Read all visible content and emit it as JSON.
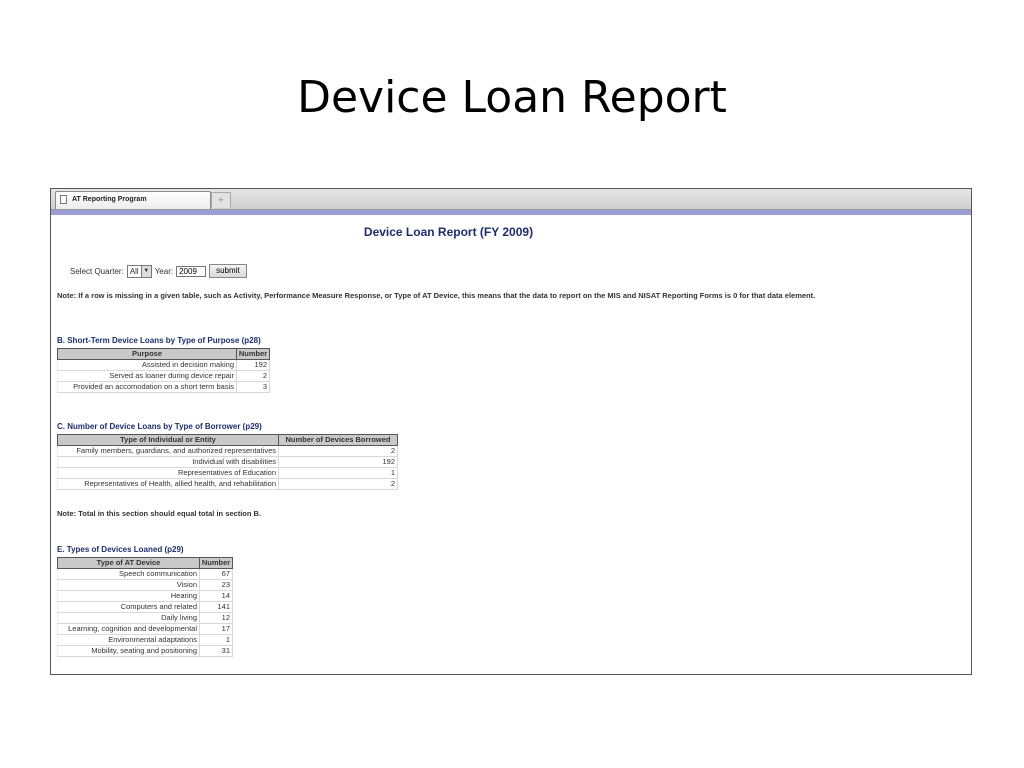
{
  "slide": {
    "title": "Device Loan Report"
  },
  "browser": {
    "tab_label": "AT Reporting Program",
    "new_tab_symbol": "+"
  },
  "report": {
    "title": "Device Loan Report (FY 2009)",
    "controls": {
      "quarter_label": "Select Quarter:",
      "quarter_value": "All",
      "year_label": "Year:",
      "year_value": "2009",
      "submit_label": "submit"
    },
    "note": "Note: If a row is missing in a given table, such as Activity, Performance Measure Response, or Type of AT Device, this means that the data to report on the MIS and NISAT Reporting Forms is 0 for that data element.",
    "section_b": {
      "title": "B. Short-Term Device Loans by Type of Purpose (p28)",
      "headers": [
        "Purpose",
        "Number"
      ],
      "rows": [
        [
          "Assisted in decision making",
          "192"
        ],
        [
          "Served as loaner during device repair",
          "2"
        ],
        [
          "Provided an accomodation on a short term basis",
          "3"
        ]
      ]
    },
    "section_c": {
      "title": "C. Number of Device Loans by Type of Borrower (p29)",
      "headers": [
        "Type of Individual or Entity",
        "Number of Devices Borrowed"
      ],
      "rows": [
        [
          "Family members, guardians, and authorized representatives",
          "2"
        ],
        [
          "Individual with disabilities",
          "192"
        ],
        [
          "Representatives of Education",
          "1"
        ],
        [
          "Representatives of Health, allied health, and rehabilitation",
          "2"
        ]
      ],
      "note": "Note: Total in this section should equal total in section B."
    },
    "section_e": {
      "title": "E. Types of Devices Loaned (p29)",
      "headers": [
        "Type of AT Device",
        "Number"
      ],
      "rows": [
        [
          "Speech communication",
          "67"
        ],
        [
          "Vision",
          "23"
        ],
        [
          "Hearing",
          "14"
        ],
        [
          "Computers and related",
          "141"
        ],
        [
          "Daily living",
          "12"
        ],
        [
          "Learning, cognition and developmental",
          "17"
        ],
        [
          "Environmental adaptations",
          "1"
        ],
        [
          "Mobility, seating and positioning",
          "31"
        ]
      ]
    }
  }
}
